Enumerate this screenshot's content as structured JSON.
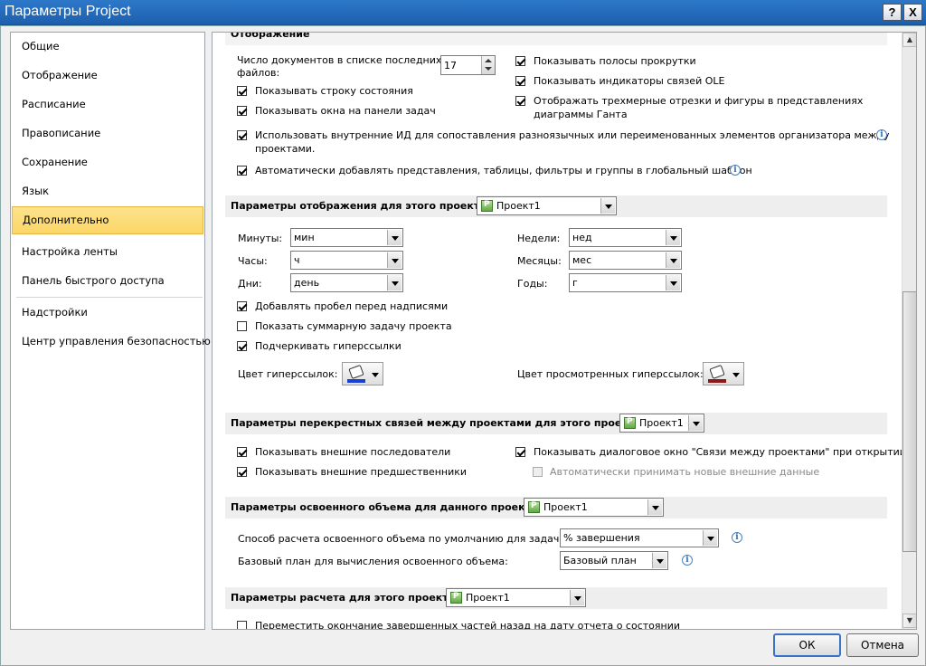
{
  "window": {
    "title": "Параметры Project",
    "help_label": "?",
    "close_label": "X"
  },
  "nav": {
    "items": [
      "Общие",
      "Отображение",
      "Расписание",
      "Правописание",
      "Сохранение",
      "Язык",
      "Дополнительно",
      "Настройка ленты",
      "Панель быстрого доступа",
      "Надстройки",
      "Центр управления безопасностью"
    ],
    "selected": "Дополнительно"
  },
  "display": {
    "section_title": "Отображение",
    "recent_docs_label_1": "Число документов в списке последних",
    "recent_docs_label_2": "файлов:",
    "recent_docs_value": "17",
    "show_status_bar": "Показывать строку состояния",
    "show_taskbar_windows": "Показывать окна на панели задач",
    "show_scrollbars": "Показывать полосы прокрутки",
    "show_ole_indicators": "Показывать индикаторы связей OLE",
    "gantt_3d_1": "Отображать трехмерные отрезки и фигуры в представлениях",
    "gantt_3d_2": "диаграммы Ганта",
    "internal_ids_1": "Использовать внутренние ИД для сопоставления разноязычных или переименованных элементов организатора между",
    "internal_ids_2": "проектами.",
    "auto_add_views": "Автоматически добавлять представления, таблицы, фильтры и группы в глобальный шаблон"
  },
  "project_display": {
    "section_title": "Параметры отображения для этого проекта:",
    "project": "Проект1",
    "minutes_label": "Минуты:",
    "minutes_value": "мин",
    "hours_label": "Часы:",
    "hours_value": "ч",
    "days_label": "Дни:",
    "days_value": "день",
    "weeks_label": "Недели:",
    "weeks_value": "нед",
    "months_label": "Месяцы:",
    "months_value": "мес",
    "years_label": "Годы:",
    "years_value": "г",
    "add_space": "Добавлять пробел перед надписями",
    "show_summary": "Показать суммарную задачу проекта",
    "underline_links": "Подчеркивать гиперссылки",
    "link_color_label": "Цвет гиперссылок:",
    "visited_color_label": "Цвет просмотренных гиперссылок:",
    "link_color": "#1a3fd6",
    "visited_color": "#8b1a1a"
  },
  "cross_links": {
    "section_title": "Параметры перекрестных связей между проектами для этого проекта:",
    "project": "Проект1",
    "show_successors": "Показывать внешние последователи",
    "show_predecessors": "Показывать внешние предшественники",
    "show_links_dialog": "Показывать диалоговое окно \"Связи между проектами\" при открытии",
    "auto_accept": "Автоматически принимать новые внешние данные"
  },
  "earned_value": {
    "section_title": "Параметры освоенного объема для данного проекта:",
    "project": "Проект1",
    "method_label": "Способ расчета освоенного объема по умолчанию для задач:",
    "method_value": "% завершения",
    "baseline_label": "Базовый план для вычисления освоенного объема:",
    "baseline_value": "Базовый план"
  },
  "calc": {
    "section_title": "Параметры расчета для этого проекта:",
    "project": "Проект1",
    "move_end": "Переместить окончание завершенных частей назад на дату отчета о состоянии"
  },
  "footer": {
    "ok_label": "ОК",
    "cancel_label": "Отмена"
  }
}
